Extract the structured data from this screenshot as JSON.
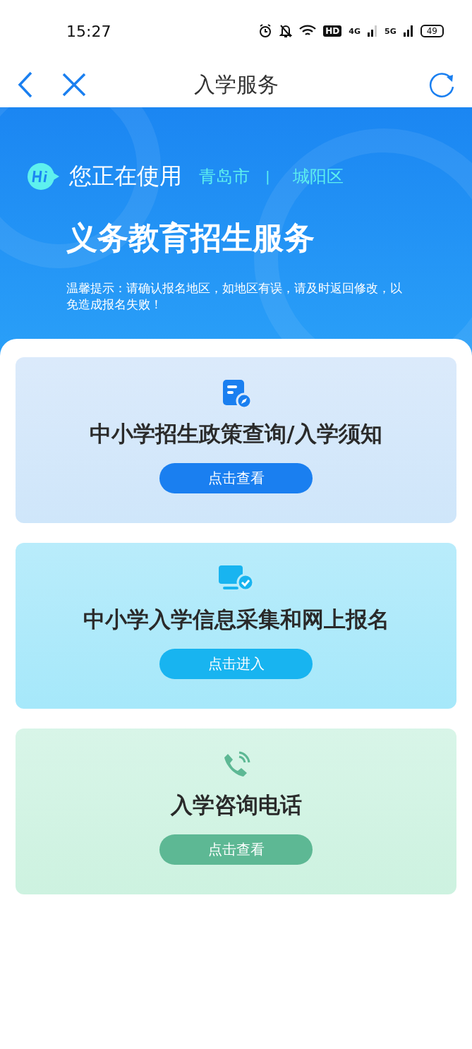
{
  "status_bar": {
    "time": "15:27",
    "hd": "HD",
    "network_1": "4G",
    "network_2": "5G",
    "battery": "49"
  },
  "nav": {
    "title": "入学服务"
  },
  "banner": {
    "using_label": "您正在使用",
    "city": "青岛市",
    "separator": "|",
    "district": "城阳区",
    "title": "义务教育招生服务",
    "notice": "温馨提示：请确认报名地区，如地区有误，请及时返回修改，以免造成报名失败！"
  },
  "cards": [
    {
      "kind": "policy",
      "title": "中小学招生政策查询/入学须知",
      "button": "点击查看",
      "color": "#1a7ff0"
    },
    {
      "kind": "enroll",
      "title": "中小学入学信息采集和网上报名",
      "button": "点击进入",
      "color": "#18b4f0"
    },
    {
      "kind": "phone",
      "title": "入学咨询电话",
      "button": "点击查看",
      "color": "#5db894"
    }
  ]
}
